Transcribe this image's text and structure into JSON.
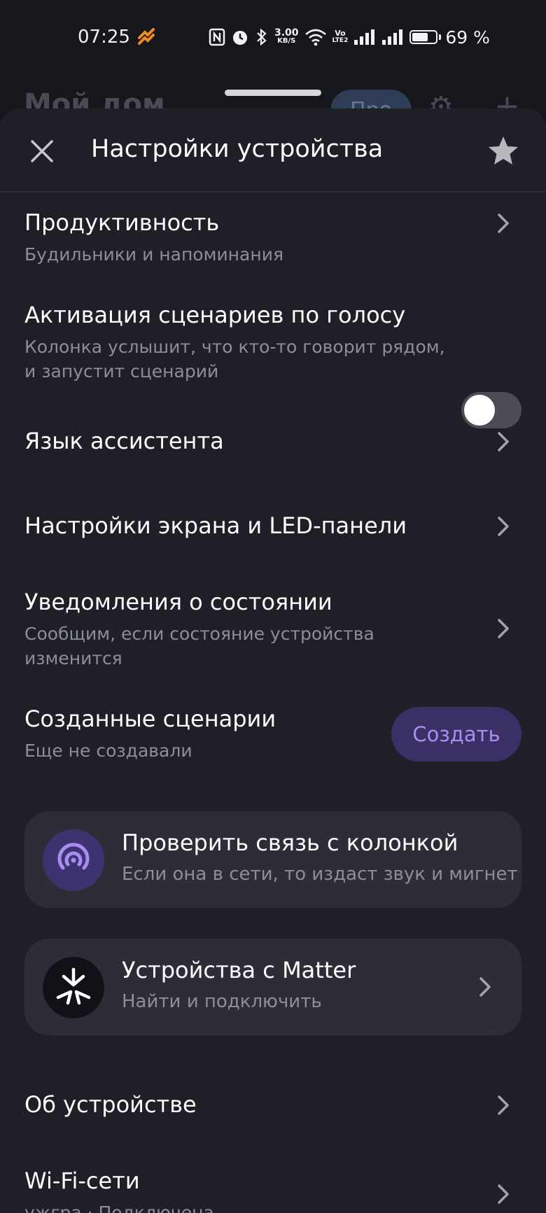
{
  "status_bar": {
    "time": "07:25",
    "network_speed_value": "3.00",
    "network_speed_unit": "KB/S",
    "volte_top": "Vo",
    "volte_bottom": "LTE2",
    "battery_percent": "69 %",
    "battery_level": 0.69,
    "icons": [
      "app-notification-icon",
      "nfc-icon",
      "alarm-icon",
      "bluetooth-icon",
      "wifi-icon",
      "signal-icon",
      "signal-icon",
      "battery-icon"
    ]
  },
  "background_screen": {
    "title": "Мой дом",
    "pill": "Про"
  },
  "header": {
    "title": "Настройки устройства"
  },
  "settings": {
    "productivity": {
      "title": "Продуктивность",
      "subtitle": "Будильники и напоминания"
    },
    "voice_activation": {
      "title": "Активация сценариев по голосу",
      "subtitle_line1": "Колонка услышит, что кто-то говорит рядом,",
      "subtitle_line2": "и запустит сценарий",
      "enabled": false
    },
    "assistant_language": {
      "title": "Язык ассистента"
    },
    "screen_led": {
      "title": "Настройки экрана и LED-панели"
    },
    "status_notifications": {
      "title": "Уведомления о состоянии",
      "subtitle_line1": "Сообщим, если состояние устройства",
      "subtitle_line2": "изменится"
    },
    "created_scenarios": {
      "title": "Созданные сценарии",
      "subtitle": "Еще не создавали",
      "button": "Создать"
    },
    "check_connection": {
      "title": "Проверить связь с колонкой",
      "subtitle": "Если она в сети, то издаст звук и мигнет"
    },
    "matter": {
      "title": "Устройства с Matter",
      "subtitle": "Найти и подключить"
    },
    "about": {
      "title": "Об устройстве"
    },
    "wifi": {
      "title": "Wi-Fi-сети",
      "subtitle": "ужгра · Подключена"
    }
  },
  "colors": {
    "sheet_bg": "#1e1f27",
    "card_bg": "#2c2d37",
    "accent_purple": "#a88ef0",
    "accent_button_bg": "#3a3065"
  }
}
